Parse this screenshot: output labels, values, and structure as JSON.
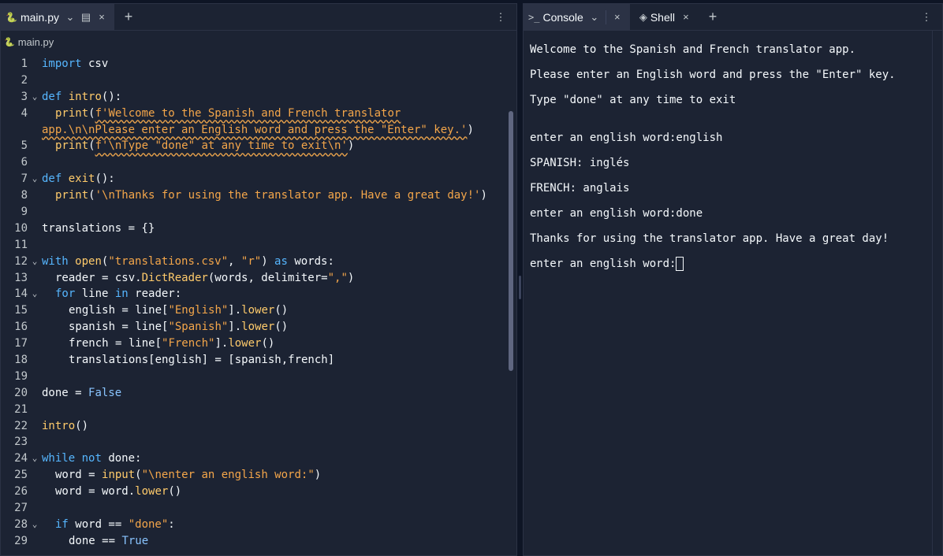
{
  "editor": {
    "tab_label": "main.py",
    "breadcrumb_file": "main.py",
    "lines": [
      {
        "n": "1",
        "fold": false,
        "indent": 0,
        "tokens": [
          {
            "t": "import",
            "c": "kw"
          },
          {
            "t": " csv"
          }
        ]
      },
      {
        "n": "2",
        "fold": false,
        "indent": 0,
        "tokens": []
      },
      {
        "n": "3",
        "fold": true,
        "indent": 0,
        "tokens": [
          {
            "t": "def",
            "c": "kw"
          },
          {
            "t": " "
          },
          {
            "t": "intro",
            "c": "fn"
          },
          {
            "t": "():"
          }
        ]
      },
      {
        "n": "4",
        "fold": false,
        "indent": 1,
        "tokens": [
          {
            "t": "print",
            "c": "fn"
          },
          {
            "t": "("
          },
          {
            "t": "f'Welcome to the Spanish and French translator",
            "c": "str squig"
          }
        ]
      },
      {
        "n": "",
        "fold": false,
        "indent": 0,
        "tokens": [
          {
            "t": "app.\\n\\nPlease enter an English word and press the \"Enter\" key.'",
            "c": "str squig"
          },
          {
            "t": ")"
          }
        ]
      },
      {
        "n": "5",
        "fold": false,
        "indent": 1,
        "tokens": [
          {
            "t": "print",
            "c": "fn"
          },
          {
            "t": "("
          },
          {
            "t": "f'\\nType \"done\" at any time to exit\\n'",
            "c": "str squig"
          },
          {
            "t": ")"
          }
        ]
      },
      {
        "n": "6",
        "fold": false,
        "indent": 0,
        "tokens": []
      },
      {
        "n": "7",
        "fold": true,
        "indent": 0,
        "tokens": [
          {
            "t": "def",
            "c": "kw"
          },
          {
            "t": " "
          },
          {
            "t": "exit",
            "c": "fn"
          },
          {
            "t": "():"
          }
        ]
      },
      {
        "n": "8",
        "fold": false,
        "indent": 1,
        "tokens": [
          {
            "t": "print",
            "c": "fn"
          },
          {
            "t": "("
          },
          {
            "t": "'\\nThanks for using the translator app. Have a great day!'",
            "c": "str"
          },
          {
            "t": ")"
          }
        ]
      },
      {
        "n": "9",
        "fold": false,
        "indent": 0,
        "tokens": []
      },
      {
        "n": "10",
        "fold": false,
        "indent": 0,
        "tokens": [
          {
            "t": "translations = {}"
          }
        ]
      },
      {
        "n": "11",
        "fold": false,
        "indent": 0,
        "tokens": []
      },
      {
        "n": "12",
        "fold": true,
        "indent": 0,
        "tokens": [
          {
            "t": "with",
            "c": "kw"
          },
          {
            "t": " "
          },
          {
            "t": "open",
            "c": "fn"
          },
          {
            "t": "("
          },
          {
            "t": "\"translations.csv\"",
            "c": "str"
          },
          {
            "t": ", "
          },
          {
            "t": "\"r\"",
            "c": "str"
          },
          {
            "t": ") "
          },
          {
            "t": "as",
            "c": "kw"
          },
          {
            "t": " words:"
          }
        ]
      },
      {
        "n": "13",
        "fold": false,
        "indent": 1,
        "tokens": [
          {
            "t": "reader = csv."
          },
          {
            "t": "DictReader",
            "c": "fn"
          },
          {
            "t": "(words, delimiter="
          },
          {
            "t": "\",\"",
            "c": "str"
          },
          {
            "t": ")"
          }
        ]
      },
      {
        "n": "14",
        "fold": true,
        "indent": 1,
        "tokens": [
          {
            "t": "for",
            "c": "kw"
          },
          {
            "t": " line "
          },
          {
            "t": "in",
            "c": "kw"
          },
          {
            "t": " reader:"
          }
        ]
      },
      {
        "n": "15",
        "fold": false,
        "indent": 2,
        "tokens": [
          {
            "t": "english = line["
          },
          {
            "t": "\"English\"",
            "c": "str"
          },
          {
            "t": "]."
          },
          {
            "t": "lower",
            "c": "fn"
          },
          {
            "t": "()"
          }
        ]
      },
      {
        "n": "16",
        "fold": false,
        "indent": 2,
        "tokens": [
          {
            "t": "spanish = line["
          },
          {
            "t": "\"Spanish\"",
            "c": "str"
          },
          {
            "t": "]."
          },
          {
            "t": "lower",
            "c": "fn"
          },
          {
            "t": "()"
          }
        ]
      },
      {
        "n": "17",
        "fold": false,
        "indent": 2,
        "tokens": [
          {
            "t": "french = line["
          },
          {
            "t": "\"French\"",
            "c": "str"
          },
          {
            "t": "]."
          },
          {
            "t": "lower",
            "c": "fn"
          },
          {
            "t": "()"
          }
        ]
      },
      {
        "n": "18",
        "fold": false,
        "indent": 2,
        "tokens": [
          {
            "t": "translations[english] = [spanish,french]"
          }
        ]
      },
      {
        "n": "19",
        "fold": false,
        "indent": 0,
        "tokens": []
      },
      {
        "n": "20",
        "fold": false,
        "indent": 0,
        "tokens": [
          {
            "t": "done = "
          },
          {
            "t": "False",
            "c": "const"
          }
        ]
      },
      {
        "n": "21",
        "fold": false,
        "indent": 0,
        "tokens": []
      },
      {
        "n": "22",
        "fold": false,
        "indent": 0,
        "tokens": [
          {
            "t": "intro",
            "c": "fn"
          },
          {
            "t": "()"
          }
        ]
      },
      {
        "n": "23",
        "fold": false,
        "indent": 0,
        "tokens": []
      },
      {
        "n": "24",
        "fold": true,
        "indent": 0,
        "tokens": [
          {
            "t": "while",
            "c": "kw"
          },
          {
            "t": " "
          },
          {
            "t": "not",
            "c": "kw"
          },
          {
            "t": " done:"
          }
        ]
      },
      {
        "n": "25",
        "fold": false,
        "indent": 1,
        "tokens": [
          {
            "t": "word = "
          },
          {
            "t": "input",
            "c": "fn"
          },
          {
            "t": "("
          },
          {
            "t": "\"\\nenter an english word:\"",
            "c": "str"
          },
          {
            "t": ")"
          }
        ]
      },
      {
        "n": "26",
        "fold": false,
        "indent": 1,
        "tokens": [
          {
            "t": "word = word."
          },
          {
            "t": "lower",
            "c": "fn"
          },
          {
            "t": "()"
          }
        ]
      },
      {
        "n": "27",
        "fold": false,
        "indent": 0,
        "tokens": []
      },
      {
        "n": "28",
        "fold": true,
        "indent": 1,
        "tokens": [
          {
            "t": "if",
            "c": "kw"
          },
          {
            "t": " word == "
          },
          {
            "t": "\"done\"",
            "c": "str"
          },
          {
            "t": ":"
          }
        ]
      },
      {
        "n": "29",
        "fold": false,
        "indent": 2,
        "tokens": [
          {
            "t": "done == "
          },
          {
            "t": "True",
            "c": "const"
          }
        ]
      }
    ]
  },
  "console": {
    "tab_console": "Console",
    "tab_shell": "Shell",
    "lines": [
      "Welcome to the Spanish and French translator app.",
      "Please enter an English word and press the \"Enter\" key.",
      "Type \"done\" at any time to exit",
      "",
      "enter an english word:english",
      "SPANISH: inglés",
      "FRENCH: anglais",
      "enter an english word:done",
      "Thanks for using the translator app. Have a great day!"
    ],
    "prompt": "enter an english word:"
  },
  "icons": {
    "python": "🐍",
    "chevron": "⌄",
    "close": "×",
    "plus": "+",
    "kebab": "⋮",
    "terminal": ">_",
    "shell": "◈",
    "page": "▤"
  }
}
